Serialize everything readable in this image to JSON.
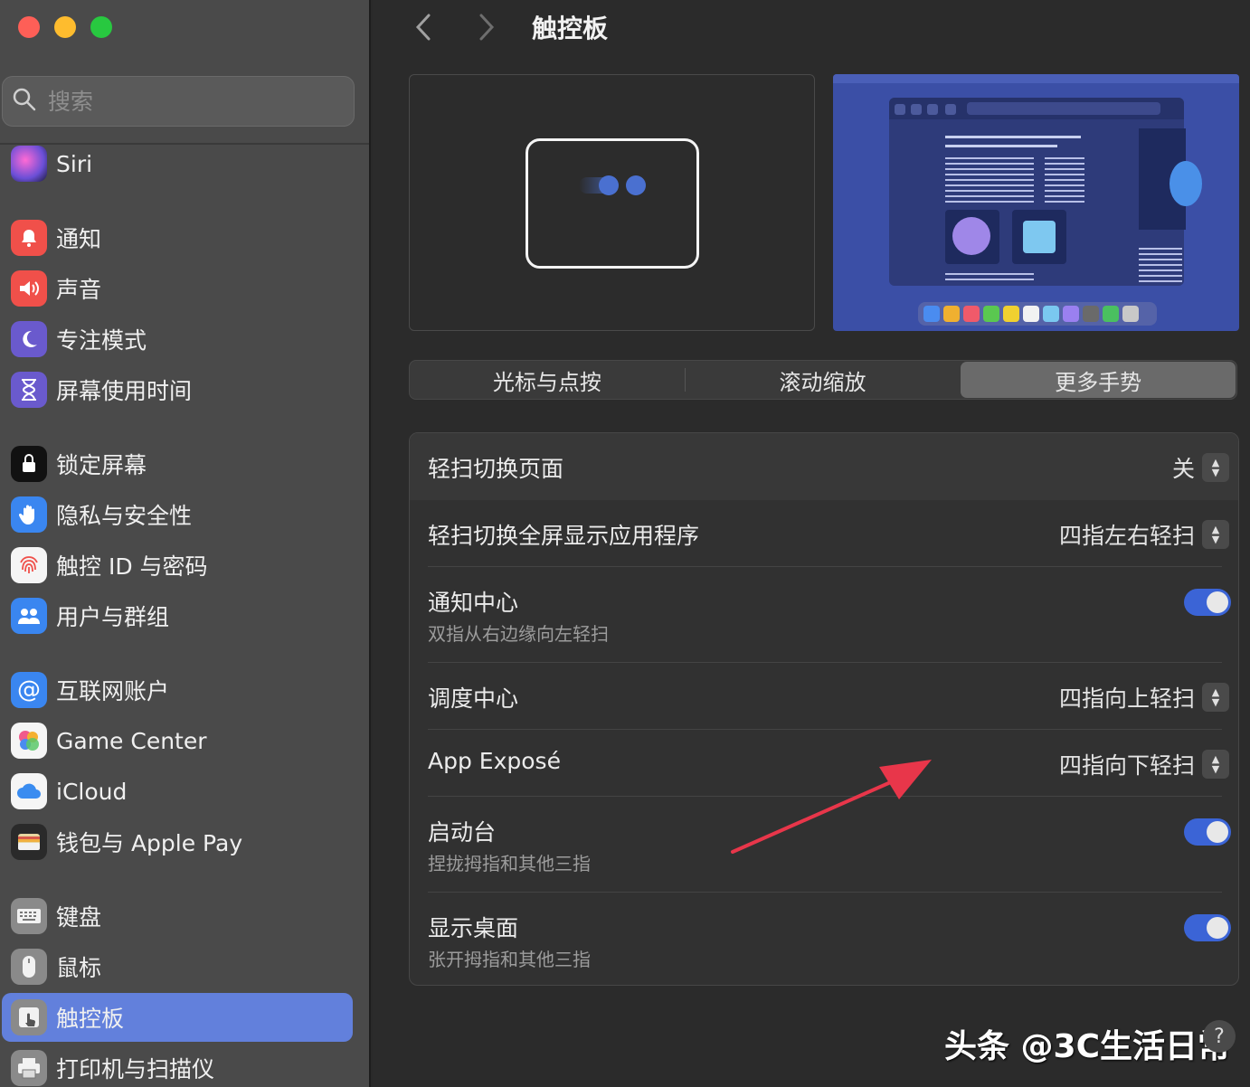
{
  "window": {
    "title": "触控板"
  },
  "search": {
    "placeholder": "搜索"
  },
  "sidebar": {
    "items": [
      {
        "label": "Siri",
        "icon": "siri-icon",
        "color": "#7a4fd6"
      },
      {
        "label": "通知",
        "icon": "bell-icon",
        "color": "#f0504a"
      },
      {
        "label": "声音",
        "icon": "speaker-icon",
        "color": "#f0504a"
      },
      {
        "label": "专注模式",
        "icon": "moon-icon",
        "color": "#6a5acd"
      },
      {
        "label": "屏幕使用时间",
        "icon": "hourglass-icon",
        "color": "#6a5acd"
      },
      {
        "label": "锁定屏幕",
        "icon": "lock-icon",
        "color": "#1a1a1a"
      },
      {
        "label": "隐私与安全性",
        "icon": "hand-icon",
        "color": "#3a86f0"
      },
      {
        "label": "触控 ID 与密码",
        "icon": "fingerprint-icon",
        "color": "#f5f5f5"
      },
      {
        "label": "用户与群组",
        "icon": "users-icon",
        "color": "#3a86f0"
      },
      {
        "label": "互联网账户",
        "icon": "at-icon",
        "color": "#3a86f0"
      },
      {
        "label": "Game Center",
        "icon": "game-center-icon",
        "color": "#f5f5f5"
      },
      {
        "label": "iCloud",
        "icon": "cloud-icon",
        "color": "#f5f5f5"
      },
      {
        "label": "钱包与 Apple Pay",
        "icon": "wallet-icon",
        "color": "#2a2a2a"
      },
      {
        "label": "键盘",
        "icon": "keyboard-icon",
        "color": "#8a8a8a"
      },
      {
        "label": "鼠标",
        "icon": "mouse-icon",
        "color": "#8a8a8a"
      },
      {
        "label": "触控板",
        "icon": "trackpad-icon",
        "color": "#8a8a8a"
      },
      {
        "label": "打印机与扫描仪",
        "icon": "printer-icon",
        "color": "#8a8a8a"
      }
    ],
    "active_index": 15
  },
  "tabs": [
    {
      "label": "光标与点按"
    },
    {
      "label": "滚动缩放"
    },
    {
      "label": "更多手势"
    }
  ],
  "selected_tab": 2,
  "settings": {
    "swipe_pages": {
      "title": "轻扫切换页面",
      "value": "关"
    },
    "swipe_fullscreen": {
      "title": "轻扫切换全屏显示应用程序",
      "value": "四指左右轻扫"
    },
    "notification_center": {
      "title": "通知中心",
      "subtitle": "双指从右边缘向左轻扫",
      "enabled": true
    },
    "mission_control": {
      "title": "调度中心",
      "value": "四指向上轻扫"
    },
    "app_expose": {
      "title": "App Exposé",
      "value": "四指向下轻扫"
    },
    "launchpad": {
      "title": "启动台",
      "subtitle": "捏拢拇指和其他三指",
      "enabled": true
    },
    "show_desktop": {
      "title": "显示桌面",
      "subtitle": "张开拇指和其他三指",
      "enabled": true
    }
  },
  "colors": {
    "accent": "#3b64d6",
    "annotation_arrow": "#e8364a"
  },
  "watermark": {
    "text": "头条 @3C生活日常"
  }
}
